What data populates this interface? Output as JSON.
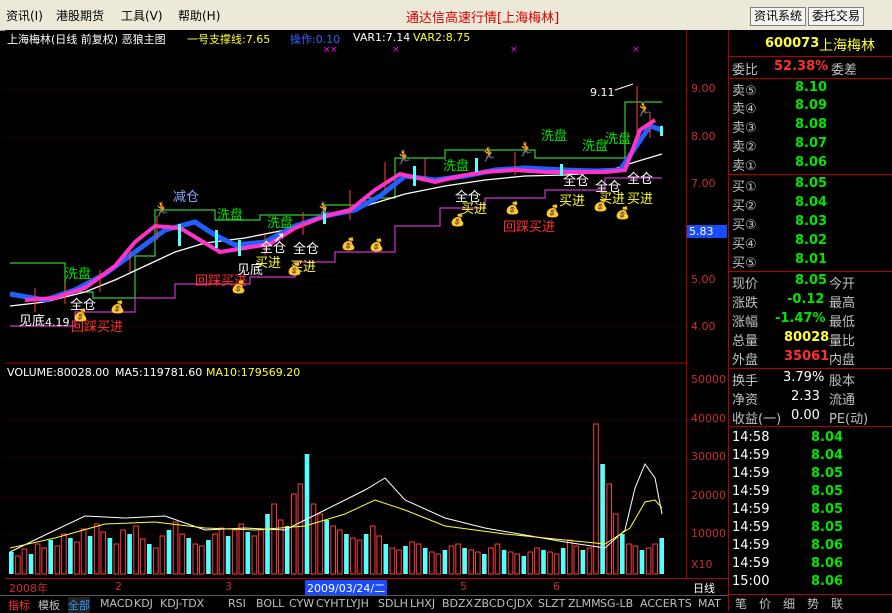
{
  "menu": [
    "资讯(I)",
    "港股期货",
    "工具(V)",
    "帮助(H)"
  ],
  "title": "通达信高速行情[上海梅林]",
  "top_buttons": [
    "资讯系统",
    "委托交易"
  ],
  "chart_header": {
    "name": "上海梅林(日线 前复权) 恶狼主图",
    "support": "一号支撑线:7.65",
    "operate": "操作:0.10",
    "var1": "VAR1:7.14",
    "var2": "VAR2:8.75"
  },
  "price_axis": [
    "9.00",
    "8.00",
    "7.00",
    "6.00",
    "5.00",
    "4.00"
  ],
  "current_price_tag": "5.83",
  "high_label": "9.11",
  "low_label": "4.19",
  "volume_header": {
    "vol": "VOLUME:80028.00",
    "ma5": "MA5:119781.60",
    "ma10": "MA10:179569.20"
  },
  "volume_axis": [
    "50000",
    "40000",
    "30000",
    "20000",
    "10000",
    "X10"
  ],
  "date_axis": [
    "2008年",
    "2",
    "3",
    "2009/03/24/二",
    "5",
    "6"
  ],
  "period_label": "日线",
  "annotations": {
    "xipan": "洗盘",
    "jiancang": "减仓",
    "quancang": "全仓",
    "maijin": "买进",
    "huicai": "回踩买进",
    "jiandi": "见底"
  },
  "bottom_tabs": [
    "指标",
    "模板",
    "全部",
    "MACD",
    "KDJ",
    "KDJ-TDX",
    "RSI",
    "BOLL",
    "CYW",
    "CYHT",
    "LYJH",
    "SDLH",
    "LHXJ",
    "BDZX",
    "ZBCD",
    "CJDX",
    "SLZT",
    "ZLMM",
    "SG-LB",
    "ACCER",
    "TS",
    "MAT"
  ],
  "right_panel": {
    "code": "600073",
    "name": "上海梅林",
    "weibi_label": "委比",
    "weibi_value": "52.38%",
    "weicha_label": "委差",
    "sell": [
      {
        "label": "卖⑤",
        "price": "8.10"
      },
      {
        "label": "卖④",
        "price": "8.09"
      },
      {
        "label": "卖③",
        "price": "8.08"
      },
      {
        "label": "卖②",
        "price": "8.07"
      },
      {
        "label": "卖①",
        "price": "8.06"
      }
    ],
    "buy": [
      {
        "label": "买①",
        "price": "8.05"
      },
      {
        "label": "买②",
        "price": "8.04"
      },
      {
        "label": "买③",
        "price": "8.03"
      },
      {
        "label": "买④",
        "price": "8.02"
      },
      {
        "label": "买⑤",
        "price": "8.01"
      }
    ],
    "quote": [
      {
        "label": "现价",
        "value": "8.05",
        "label2": "今开"
      },
      {
        "label": "涨跌",
        "value": "-0.12",
        "label2": "最高"
      },
      {
        "label": "涨幅",
        "value": "-1.47%",
        "label2": "最低"
      },
      {
        "label": "总量",
        "value": "80028",
        "label2": "量比"
      },
      {
        "label": "外盘",
        "value": "35061",
        "label2": "内盘"
      }
    ],
    "stats": [
      {
        "label": "换手",
        "value": "3.79%",
        "label2": "股本"
      },
      {
        "label": "净资",
        "value": "2.33",
        "label2": "流通"
      },
      {
        "label": "收益(一)",
        "value": "0.00",
        "label2": "PE(动)"
      }
    ],
    "ticks": [
      {
        "time": "14:58",
        "price": "8.04"
      },
      {
        "time": "14:59",
        "price": "8.04"
      },
      {
        "time": "14:59",
        "price": "8.05"
      },
      {
        "time": "14:59",
        "price": "8.05"
      },
      {
        "time": "14:59",
        "price": "8.05"
      },
      {
        "time": "14:59",
        "price": "8.05"
      },
      {
        "time": "14:59",
        "price": "8.06"
      },
      {
        "time": "14:59",
        "price": "8.06"
      },
      {
        "time": "15:00",
        "price": "8.06"
      }
    ],
    "bottom_tabs": [
      "笔",
      "价",
      "细",
      "势",
      "联"
    ]
  }
}
